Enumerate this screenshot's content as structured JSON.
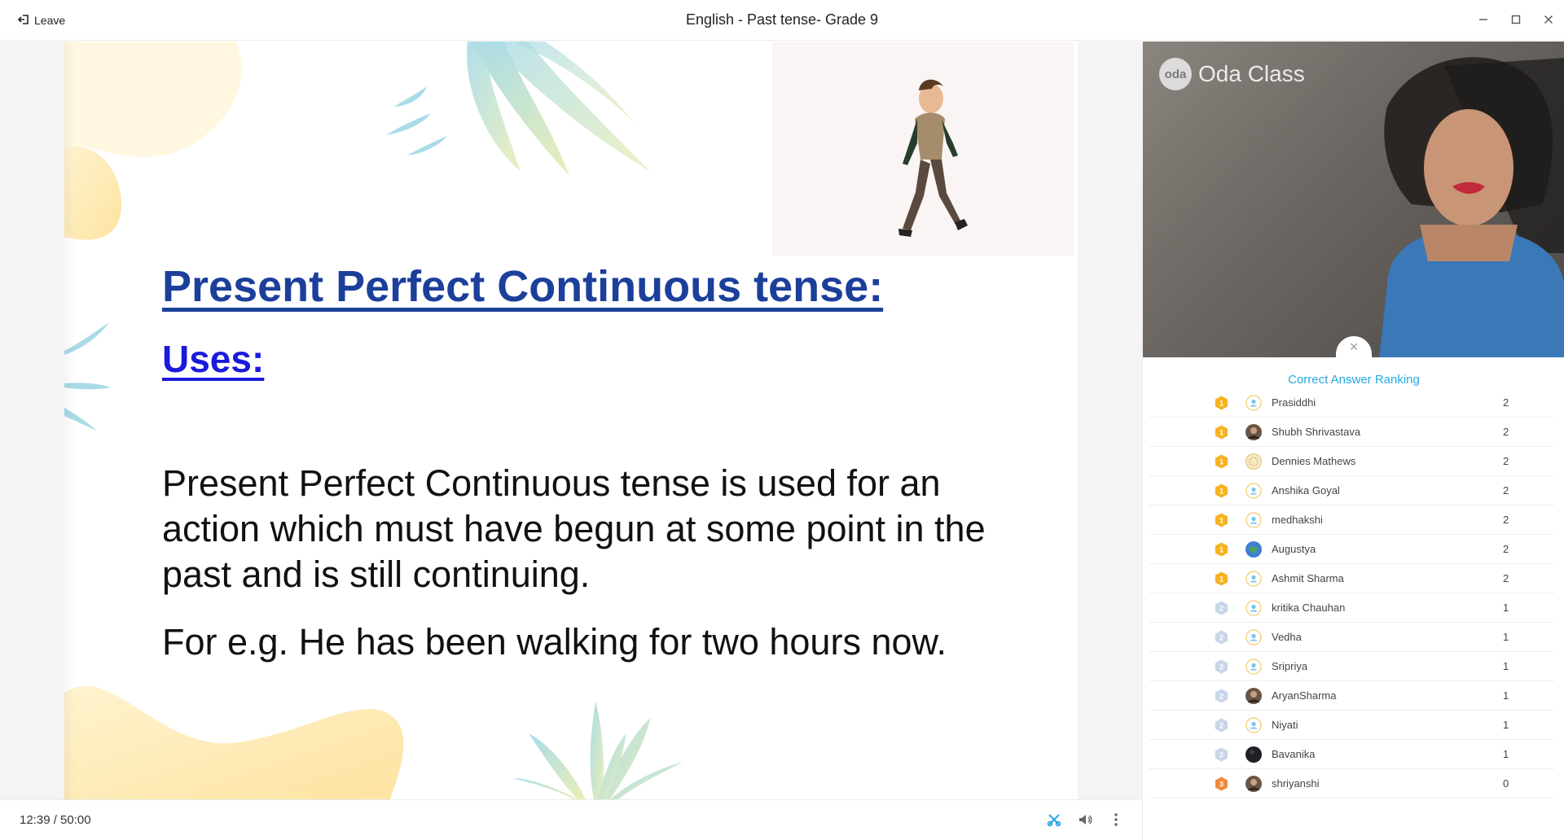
{
  "titlebar": {
    "leave_label": "Leave",
    "title": "English - Past tense- Grade 9",
    "controls": [
      "minimize-icon",
      "maximize-icon",
      "close-icon"
    ]
  },
  "slide": {
    "heading": "Present Perfect Continuous tense:",
    "subheading": "Uses:",
    "body": "Present Perfect Continuous tense is used for an action which must have begun at some point in the past and is still continuing.",
    "example": "For e.g. He has been walking for two hours now.",
    "colors": {
      "heading": "#1b3f9a",
      "subheading": "#1a1adb"
    }
  },
  "bottombar": {
    "timer": "12:39 / 50:00",
    "icons": [
      "tools-icon",
      "volume-icon",
      "more-icon"
    ]
  },
  "video": {
    "brand": "Oda Class",
    "brand_mark": "oda"
  },
  "ranking": {
    "title": "Correct Answer Ranking",
    "colors": {
      "title": "#25a9e0",
      "gold": "#f5b324",
      "silver": "#c9d5ea",
      "bronze": "#f08a3c"
    },
    "rows": [
      {
        "name": "Prasiddhi",
        "score": "2",
        "medal": "gold",
        "avatar": "default"
      },
      {
        "name": "Shubh Shrivastava",
        "score": "2",
        "medal": "gold",
        "avatar": "photo"
      },
      {
        "name": "Dennies Mathews",
        "score": "2",
        "medal": "gold",
        "avatar": "pattern"
      },
      {
        "name": "Anshika Goyal",
        "score": "2",
        "medal": "gold",
        "avatar": "default"
      },
      {
        "name": "medhakshi",
        "score": "2",
        "medal": "gold",
        "avatar": "default"
      },
      {
        "name": "Augustya",
        "score": "2",
        "medal": "gold",
        "avatar": "globe"
      },
      {
        "name": "Ashmit Sharma",
        "score": "2",
        "medal": "gold",
        "avatar": "default"
      },
      {
        "name": "kritika Chauhan",
        "score": "1",
        "medal": "silver",
        "avatar": "default"
      },
      {
        "name": "Vedha",
        "score": "1",
        "medal": "silver",
        "avatar": "default"
      },
      {
        "name": "Sripriya",
        "score": "1",
        "medal": "silver",
        "avatar": "default"
      },
      {
        "name": "AryanSharma",
        "score": "1",
        "medal": "silver",
        "avatar": "photo"
      },
      {
        "name": "Niyati",
        "score": "1",
        "medal": "silver",
        "avatar": "default"
      },
      {
        "name": "Bavanika",
        "score": "1",
        "medal": "silver",
        "avatar": "dark"
      },
      {
        "name": "shriyanshi",
        "score": "0",
        "medal": "bronze",
        "avatar": "photo"
      }
    ]
  }
}
